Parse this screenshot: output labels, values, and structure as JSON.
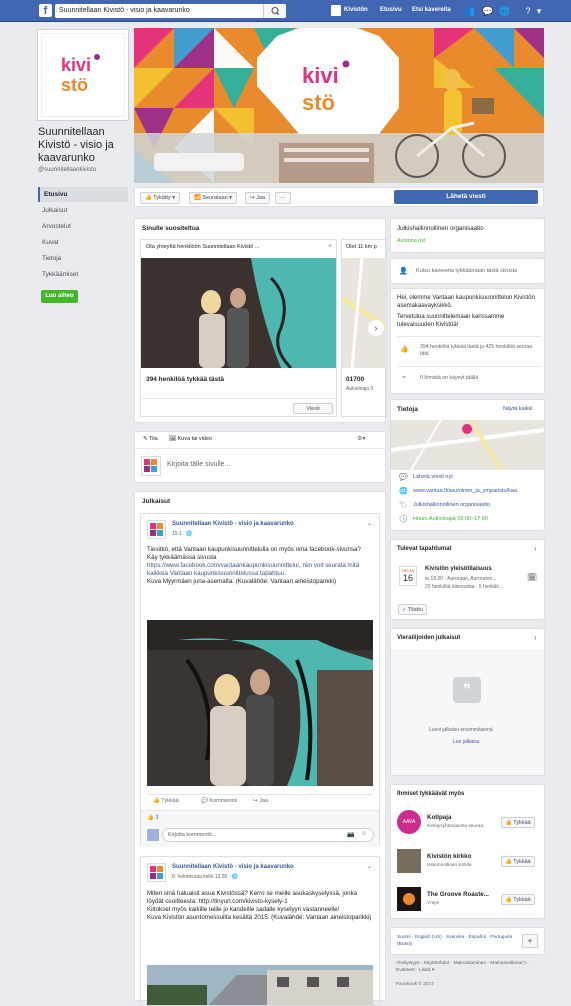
{
  "topbar": {
    "search_value": "Suunnitellaan Kivistö - visio ja kaavarunko",
    "links": [
      "Kivistön",
      "Etusivu",
      "Etsi kavereita"
    ]
  },
  "page": {
    "name": "Suunnitellaan Kivistö - visio ja kaavarunko",
    "handle": "@suunnitellaankivisto"
  },
  "left_nav": [
    "Etusivu",
    "Julkaisut",
    "Arvostelut",
    "Kuvat",
    "Tietoja",
    "Tykkäämiset"
  ],
  "promote_label": "Luo aiheo",
  "action_bar": {
    "liked": "Tykätty",
    "following": "Seurataan",
    "share": "Jaa",
    "more": "···",
    "send_message": "Lähetä viesti"
  },
  "suggested": {
    "title": "Sinulle suositeltua",
    "card1_text": "Ota yhteyttä henkilöön Suunnitellaan Kivistö ...",
    "card1_likes": "394 henkilöä tykkää tästä",
    "card1_button": "Viesti",
    "card2_text": "Olet 11 km p",
    "card2_title": "01700",
    "card2_sub": "Aukioloaja 0"
  },
  "composer": {
    "tab1": "Tila",
    "tab2": "Kuva tai video",
    "placeholder": "Kirjoita tälle sivulle..."
  },
  "posts_header": "Julkaisut",
  "post1": {
    "author": "Suunnitellaan Kivistö - visio ja kaavarunko",
    "meta": "19.1 · 🌐",
    "lines": [
      "Tiesitkö, että Vantaan kaupunkisuunnittelulla on myös oma facebook-sivunsa?",
      "Käy tykkäämässä sivusta",
      "https://www.facebook.com/vantaankaupunkisuunnittelu/, niin voit seurata mitä kaikkea Vantaan kaupunkisuunnittelussa tapahtuu.",
      "Kuva Myyrmäen juna-asemalta. (Kuvalähde: Vantaan aineistopankki)"
    ],
    "actions": [
      "Tykkää",
      "Kommentoi",
      "Jaa"
    ],
    "reaction_count": "3",
    "comment_placeholder": "Kirjoita kommentti..."
  },
  "post2": {
    "author": "Suunnitellaan Kivistö - visio ja kaavarunko",
    "meta": "8. helmikuuta kello 13.30 · 🌐",
    "lines": [
      "Miten sinä haluaisit asua Kivistössä? Kerro se meille asukaskyselyssä, jonka löydät osoitteesta: http://tinyurl.com/kivisto-kysely-1",
      "Kiitokset myös kaikille teille jo kandeille sadalle kyselyyn vastanneelle!",
      "Kuva Kivistön asuntomessuilta kesältä 2015. (Kuvalähde: Vantaan aineistopankki)"
    ]
  },
  "sidebar": {
    "category_title": "Julkishallinnollinen organisaatio",
    "category_sub": "Avoinna nyt",
    "invite_text": "Kutsu kavereita tykkäämään tästä sivusta",
    "about_lines": [
      "Hei, olemme Vantaan kaupunkisuunnittelun Kivistön asemakaavayksikkö.",
      "Tervetuloa suunnittelemaan kanssamme tulevaisuuden Kivistöä!"
    ],
    "likes_info": "394 henkilöä tykkää tästä ja 425 henkilöä seuraa tätä",
    "checkins": "0 ihmistä on käynyt täällä",
    "info_title": "Tietoja",
    "info_more": "Näytä kaikki",
    "info_rows": [
      "Lähetä viesti nyt",
      "www.vantaa.fi/asuminen_ja_ymparisto/kaa",
      "Julkishallinnollinen organisaatio",
      "Hours Aukioloajat 09:00–17:00"
    ],
    "events_title": "Tulevat tapahtumat",
    "event_month": "HELMI",
    "event_day": "16",
    "event_title": "Kivistön yleisötilaisuus",
    "event_sub1": "to 18.00 · Auroraan, Auroraton...",
    "event_sub2": "22 henkilöä kiinnostaa · 5 henkilö...",
    "event_button": "Tilattu",
    "visitor_title": "Vierailijoiden julkaisut",
    "visitor_empty": "Luesi julkaisu ensimmäisenä",
    "visitor_cta": "Luo julkaisu",
    "people_title": "Ihmiset tykkäävät myös",
    "people": [
      {
        "name": "Kotipaja",
        "sub": "Kehitysyhtiö/alusta seuraa",
        "btn": "Tykkää"
      },
      {
        "name": "Kivistön kirkko",
        "sub": "Uskonnollinen kohde",
        "btn": "Tykkää"
      },
      {
        "name": "The Groove Roaste...",
        "sub": "Yritys",
        "btn": "Tykkää"
      }
    ],
    "languages": "Suomi · English (US) · Svenska · Español · Português (Brasil)",
    "footer_links": "Yksityisyys · Käyttöehdot · Mainostaminen · Mainosvalinnat ▷ · Evästeet · Lisää ▾",
    "copyright": "Facebook © 2017"
  },
  "colors": {
    "brand": "#4267b2",
    "logo_pink": "#e6307f",
    "logo_orange": "#e98a2c",
    "green": "#42b72a"
  }
}
